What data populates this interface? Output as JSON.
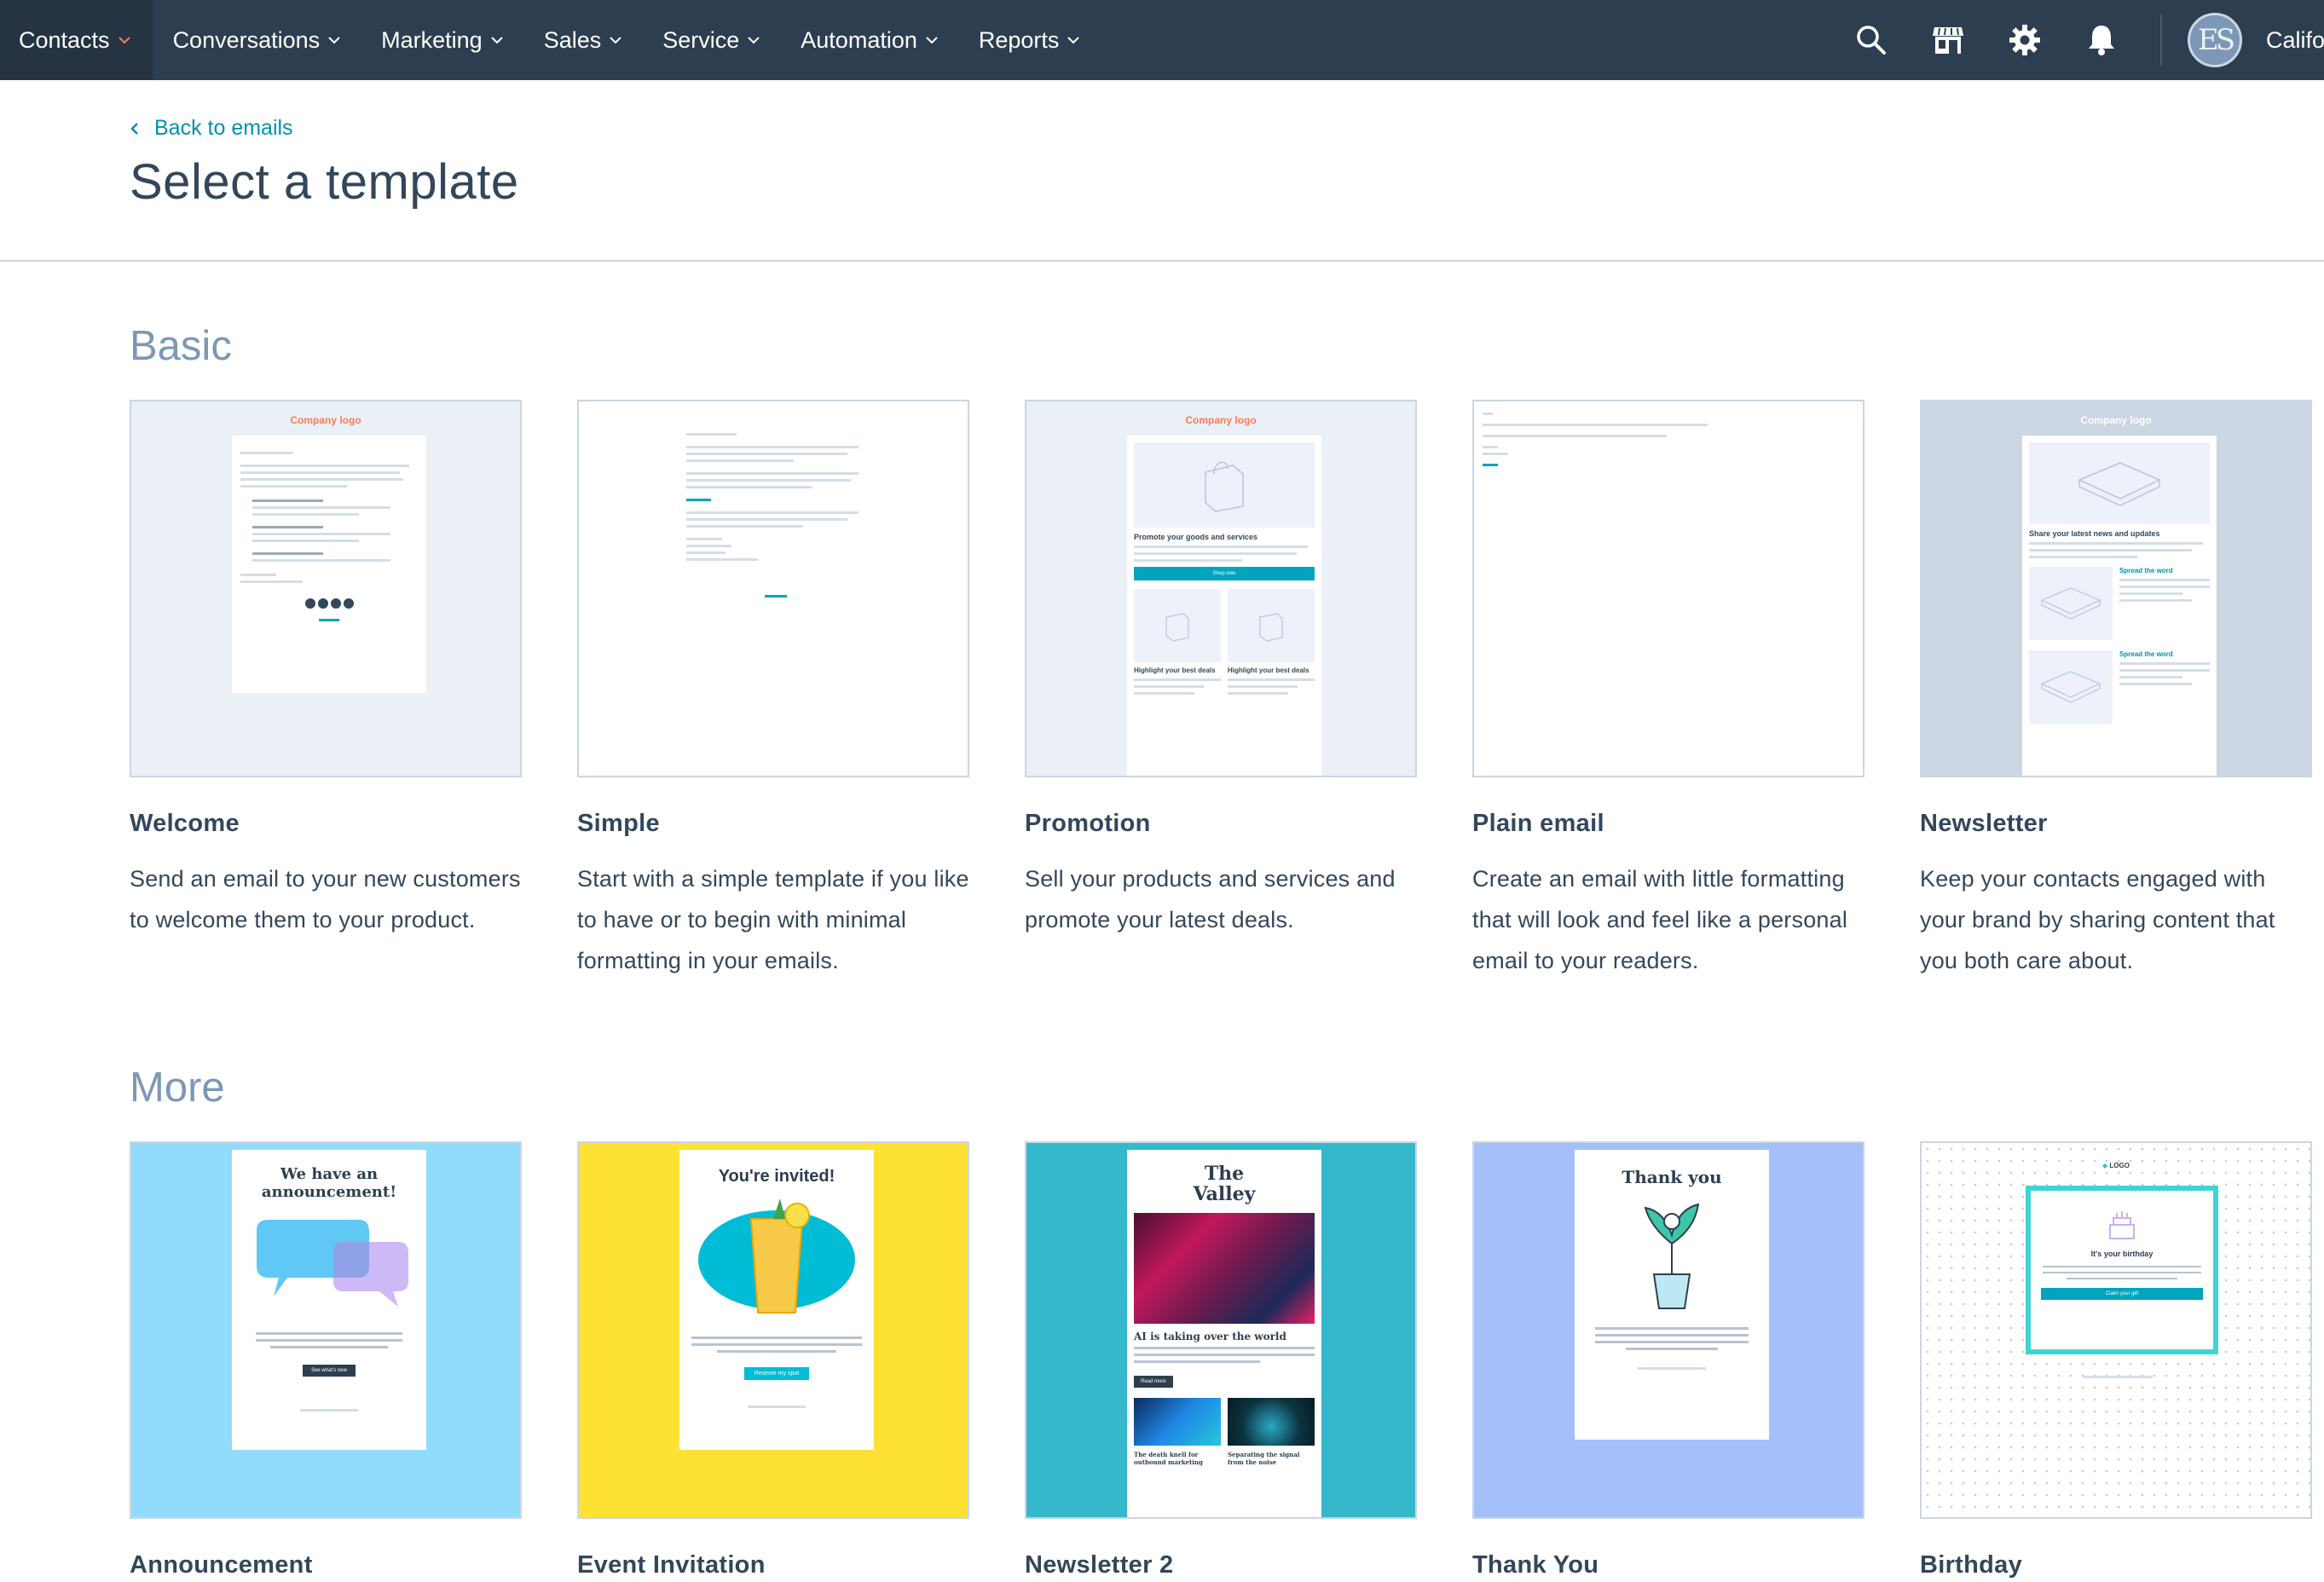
{
  "nav": {
    "items": [
      {
        "label": "Contacts",
        "active": true
      },
      {
        "label": "Conversations",
        "active": false
      },
      {
        "label": "Marketing",
        "active": false
      },
      {
        "label": "Sales",
        "active": false
      },
      {
        "label": "Service",
        "active": false
      },
      {
        "label": "Automation",
        "active": false
      },
      {
        "label": "Reports",
        "active": false
      }
    ],
    "icons": [
      "search-icon",
      "marketplace-icon",
      "settings-gear-icon",
      "notifications-bell-icon"
    ],
    "avatar_initials": "ES",
    "account_name": "California"
  },
  "header": {
    "back_label": "Back to emails",
    "title": "Select a template"
  },
  "sections": {
    "basic": {
      "title": "Basic",
      "templates": [
        {
          "name": "Welcome",
          "description": "Send an email to your new customers to welcome them to your product.",
          "thumb": {
            "logo": "Company logo"
          }
        },
        {
          "name": "Simple",
          "description": "Start with a simple template if you like to have or to begin with minimal formatting in your emails."
        },
        {
          "name": "Promotion",
          "description": "Sell your products and services and promote your latest deals.",
          "thumb": {
            "logo": "Company logo",
            "heading": "Promote your goods and services",
            "button": "Shop now",
            "sub1": "Highlight your best deals",
            "sub2": "Highlight your best deals"
          }
        },
        {
          "name": "Plain email",
          "description": "Create an email with little formatting that will look and feel like a personal email to your readers."
        },
        {
          "name": "Newsletter",
          "description": "Keep your contacts engaged with your brand by sharing content that you both care about.",
          "thumb": {
            "logo": "Company logo",
            "heading": "Share your latest news and updates",
            "sub1": "Spread the word",
            "sub2": "Spread the word"
          }
        }
      ]
    },
    "more": {
      "title": "More",
      "templates": [
        {
          "name": "Announcement",
          "thumb": {
            "headline": "We have an announcement!",
            "button": "See what's new"
          }
        },
        {
          "name": "Event Invitation",
          "thumb": {
            "headline": "You're invited!",
            "button": "Reserve my spot"
          }
        },
        {
          "name": "Newsletter 2",
          "thumb": {
            "headline": "The Valley",
            "story": "AI is taking over the world",
            "button": "Read more",
            "sub1": "The death knell for outbound marketing",
            "sub2": "Separating the signal from the noise"
          }
        },
        {
          "name": "Thank You",
          "thumb": {
            "headline": "Thank you"
          }
        },
        {
          "name": "Birthday",
          "thumb": {
            "logo": "LOGO",
            "headline": "It's your birthday",
            "button": "Claim your gift"
          }
        }
      ]
    }
  },
  "colors": {
    "nav_bg": "#2d3e50",
    "accent_orange": "#ff7a59",
    "link_teal": "#0091ae",
    "section_title": "#7c98b6",
    "announcement_bg": "#91dcfd",
    "invitation_bg": "#fee233",
    "newsletter2_bg": "#35b8cc",
    "thankyou_bg": "#a3c0fa"
  }
}
